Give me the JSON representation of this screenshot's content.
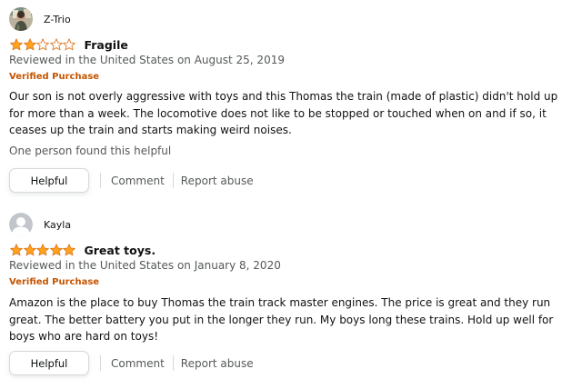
{
  "reviews": [
    {
      "profile_name": "Z-Trio",
      "avatar": "photo-avatar",
      "rating": 2,
      "rating_max": 5,
      "title": "Fragile",
      "date_line": "Reviewed in the United States on August 25, 2019",
      "badge": "Verified Purchase",
      "body": "Our son is not overly aggressive with toys and this Thomas the train (made of plastic) didn't hold up for more than a week. The locomotive does not like to be stopped or touched when on and if so, it ceases up the train and starts making weird noises.",
      "helpful_count": "One person found this helpful",
      "helpful_button": "Helpful",
      "comment_link": "Comment",
      "report_link": "Report abuse"
    },
    {
      "profile_name": "Kayla",
      "avatar": "default-user-avatar",
      "rating": 5,
      "rating_max": 5,
      "title": "Great toys.",
      "date_line": "Reviewed in the United States on January 8, 2020",
      "badge": "Verified Purchase",
      "body": "Amazon is the place to buy Thomas the train track master engines. The price is great and they run great. The better battery you put in the longer they run. My boys long these trains. Hold up well for boys who are hard on toys!",
      "helpful_button": "Helpful",
      "comment_link": "Comment",
      "report_link": "Report abuse"
    }
  ],
  "colors": {
    "star_filled": "#ffa41c",
    "star_outline": "#de7921",
    "verified": "#c45500",
    "secondary_text": "#565959",
    "button_border": "#d5d9d9"
  },
  "icons": {
    "star_filled": "filled-star-icon",
    "star_empty": "empty-star-icon"
  }
}
